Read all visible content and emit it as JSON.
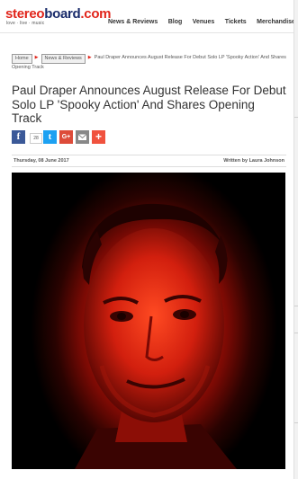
{
  "header": {
    "logo": {
      "part1": "stereo",
      "part2": "board",
      "part3": ".com",
      "tagline": "love · live · music"
    },
    "nav": [
      "News & Reviews",
      "Blog",
      "Venues",
      "Tickets",
      "Merchandise"
    ]
  },
  "breadcrumb": {
    "home": "Home",
    "section": "News & Reviews",
    "current": "Paul Draper Announces August Release For Debut Solo LP 'Spooky Action' And Shares Opening Track"
  },
  "article": {
    "title": "Paul Draper Announces August Release For Debut Solo LP 'Spooky Action' And Shares Opening Track",
    "date": "Thursday, 08 June 2017",
    "author": "Written by Laura Johnson"
  },
  "share": {
    "facebook_icon": "f",
    "count": "28",
    "twitter_icon": "t",
    "google_icon": "G+",
    "email_icon": "email-icon",
    "more_icon": "+",
    "colors": {
      "facebook": "#3b5998",
      "twitter": "#1da1f2",
      "google": "#dd4b39",
      "email": "#888888",
      "more": "#f0523e"
    }
  },
  "colors": {
    "brand_red": "#e1251b",
    "brand_blue": "#1a2c6b"
  }
}
